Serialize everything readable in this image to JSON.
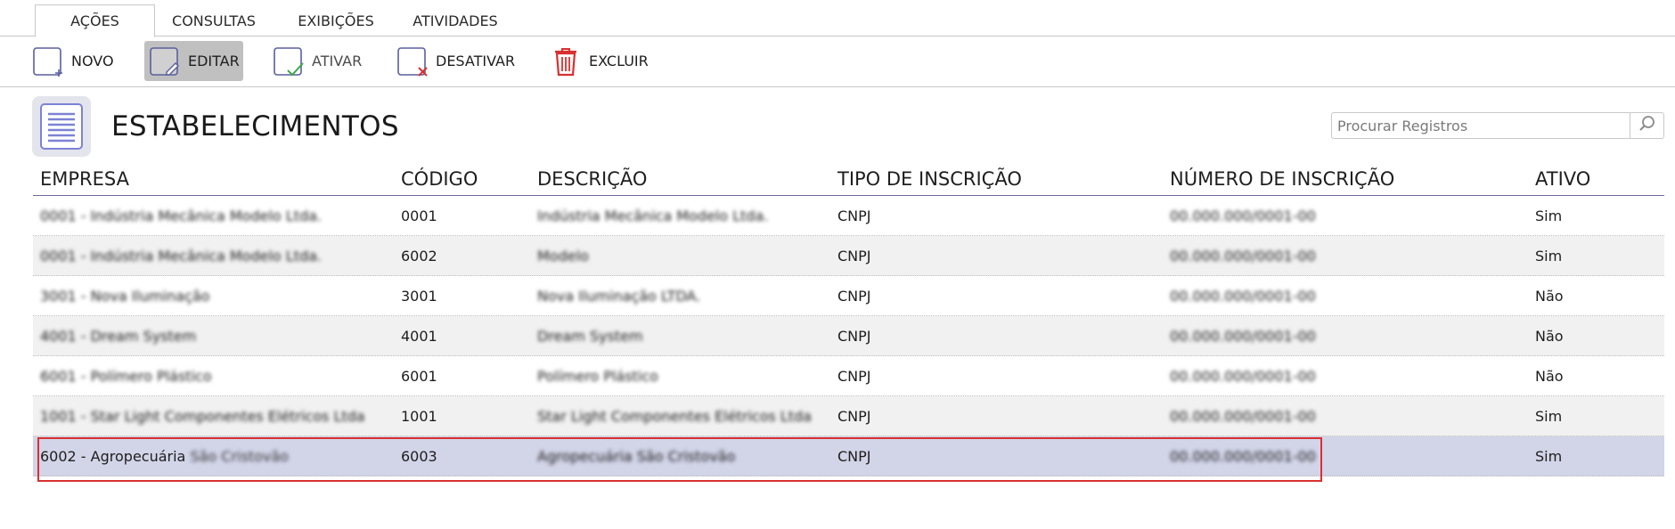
{
  "tabs": [
    "AÇÕES",
    "CONSULTAS",
    "EXIBIÇÕES",
    "ATIVIDADES"
  ],
  "toolbar": {
    "novo": "NOVO",
    "editar": "EDITAR",
    "ativar": "ATIVAR",
    "desativar": "DESATIVAR",
    "excluir": "EXCLUIR"
  },
  "page": {
    "title": "ESTABELECIMENTOS",
    "icon": "document-list-icon"
  },
  "search": {
    "placeholder": "Procurar Registros",
    "icon": "search-icon"
  },
  "table": {
    "headers": [
      "EMPRESA",
      "CÓDIGO",
      "DESCRIÇÃO",
      "TIPO DE INSCRIÇÃO",
      "NÚMERO DE INSCRIÇÃO",
      "ATIVO"
    ],
    "rows": [
      {
        "empresa": "0001 - Indústria Mecânica Modelo Ltda.",
        "codigo": "0001",
        "descricao": "Indústria Mecânica Modelo Ltda.",
        "tipo": "CNPJ",
        "numero": "00.000.000/0001-00",
        "ativo": "Sim"
      },
      {
        "empresa": "0001 - Indústria Mecânica Modelo Ltda.",
        "codigo": "6002",
        "descricao": "Modelo",
        "tipo": "CNPJ",
        "numero": "00.000.000/0001-00",
        "ativo": "Sim"
      },
      {
        "empresa": "3001 - Nova Iluminação",
        "codigo": "3001",
        "descricao": "Nova Iluminação LTDA.",
        "tipo": "CNPJ",
        "numero": "00.000.000/0001-00",
        "ativo": "Não"
      },
      {
        "empresa": "4001 - Dream System",
        "codigo": "4001",
        "descricao": "Dream System",
        "tipo": "CNPJ",
        "numero": "00.000.000/0001-00",
        "ativo": "Não"
      },
      {
        "empresa": "6001 - Polímero Plástico",
        "codigo": "6001",
        "descricao": "Polímero Plástico",
        "tipo": "CNPJ",
        "numero": "00.000.000/0001-00",
        "ativo": "Não"
      },
      {
        "empresa": "1001 - Star Light Componentes Elétricos Ltda",
        "codigo": "1001",
        "descricao": "Star Light Componentes Elétricos Ltda",
        "tipo": "CNPJ",
        "numero": "00.000.000/0001-00",
        "ativo": "Sim"
      },
      {
        "empresa_visible": "6002 - Agropecuária",
        "empresa_hidden": "São Cristovão",
        "codigo": "6003",
        "descricao": "Agropecuária São Cristovão",
        "tipo": "CNPJ",
        "numero": "00.000.000/0001-00",
        "ativo": "Sim"
      }
    ]
  }
}
